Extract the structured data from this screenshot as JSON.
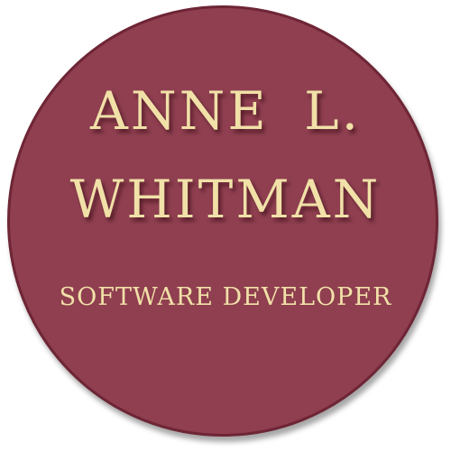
{
  "badge": {
    "name_line_1": "ANNE L.",
    "name_line_2": "WHITMAN",
    "title": "SOFTWARE DEVELOPER"
  },
  "colors": {
    "badge_fill": "#8f3f50",
    "badge_border": "#6e2535",
    "text": "#f1e1a8",
    "background": "#ffffff"
  }
}
